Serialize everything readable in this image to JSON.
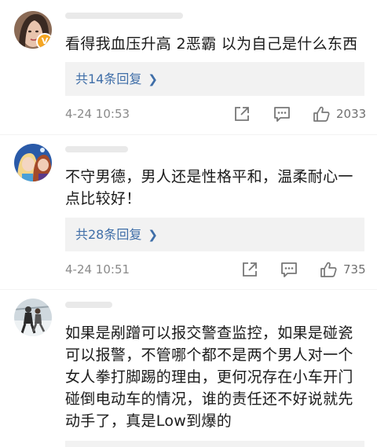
{
  "comments": [
    {
      "text": "看得我血压升高 2恶霸 以为自己是什么东西",
      "replies_label": "共14条回复",
      "time": "4-24 10:53",
      "likes": "2033",
      "verified_badge": "V"
    },
    {
      "text": "不守男德，男人还是性格平和，温柔耐心一点比较好！",
      "replies_label": "共28条回复",
      "time": "4-24 10:51",
      "likes": "735"
    },
    {
      "text": "如果是剐蹭可以报交警查监控，如果是碰瓷可以报警，不管哪个都不是两个男人对一个女人拳打脚踢的理由，更何况存在小车开门碰倒电动车的情况，谁的责任还不好说就先动手了，真是Low到爆的"
    }
  ],
  "icons": {
    "share": "share-icon",
    "comment": "comment-icon",
    "like": "thumbs-up-icon",
    "chevron": "chevron-right-icon"
  },
  "colors": {
    "link": "#3f6ea8",
    "muted": "#8a8a8a",
    "reply_bg": "#f2f2f2"
  }
}
